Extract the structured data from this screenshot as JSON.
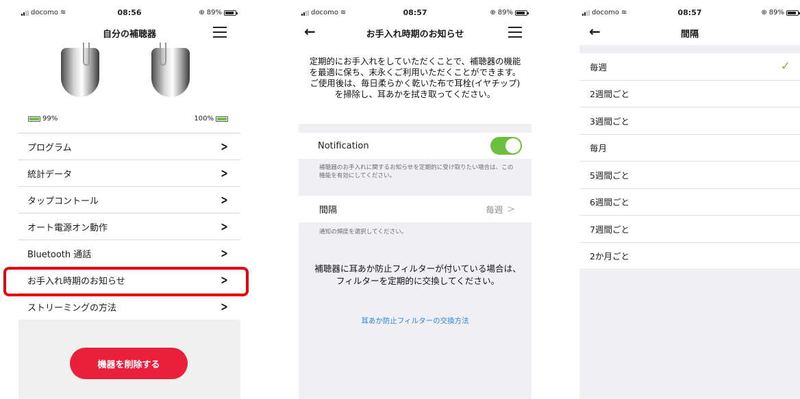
{
  "colors": {
    "accent_red": "#ea1f3c",
    "highlight_red": "#e8000b",
    "toggle_green": "#6cbf3c",
    "link_blue": "#2d82d8",
    "check_green": "#7ab648"
  },
  "screen1": {
    "status": {
      "carrier": "docomo",
      "time": "08:56",
      "battery": "89%"
    },
    "title": "自分の補聴器",
    "battery_left": "99%",
    "battery_right": "100%",
    "menu": [
      {
        "label": "プログラム"
      },
      {
        "label": "統計データ"
      },
      {
        "label": "タップコントール"
      },
      {
        "label": "オート電源オン動作"
      },
      {
        "label": "Bluetooth 通話"
      },
      {
        "label": "お手入れ時期のお知らせ"
      },
      {
        "label": "ストリーミングの方法"
      }
    ],
    "delete_button": "機器を削除する"
  },
  "screen2": {
    "status": {
      "carrier": "docomo",
      "time": "08:57",
      "battery": "89%"
    },
    "title": "お手入れ時期のお知らせ",
    "intro": "定期的にお手入れをしていただくことで、補聴器の機能を最適に保ち、末永くご利用いただくことができます。ご使用後は、毎日柔らかく乾いた布で耳栓(イヤチップ)を掃除し、耳あかを拭き取ってください。",
    "notification_label": "Notification",
    "notification_on": true,
    "notification_hint": "補聴器のお手入れに関するお知らせを定期的に受け取りたい場合は、この機能を有効にしてください。",
    "interval_label": "間隔",
    "interval_value": "毎週",
    "interval_hint": "通知の頻度を選択してください。",
    "filter_text": "補聴器に耳あか防止フィルターが付いている場合は、フィルターを定期的に交換してください。",
    "filter_link": "耳あか防止フィルターの交換方法"
  },
  "screen3": {
    "status": {
      "carrier": "docomo",
      "time": "08:57",
      "battery": "89%"
    },
    "title": "間隔",
    "options": [
      {
        "label": "毎週",
        "selected": true
      },
      {
        "label": "2週間ごと"
      },
      {
        "label": "3週間ごと"
      },
      {
        "label": "毎月"
      },
      {
        "label": "5週間ごと"
      },
      {
        "label": "6週間ごと"
      },
      {
        "label": "7週間ごと"
      },
      {
        "label": "2か月ごと"
      }
    ],
    "check_mark": "✓"
  }
}
